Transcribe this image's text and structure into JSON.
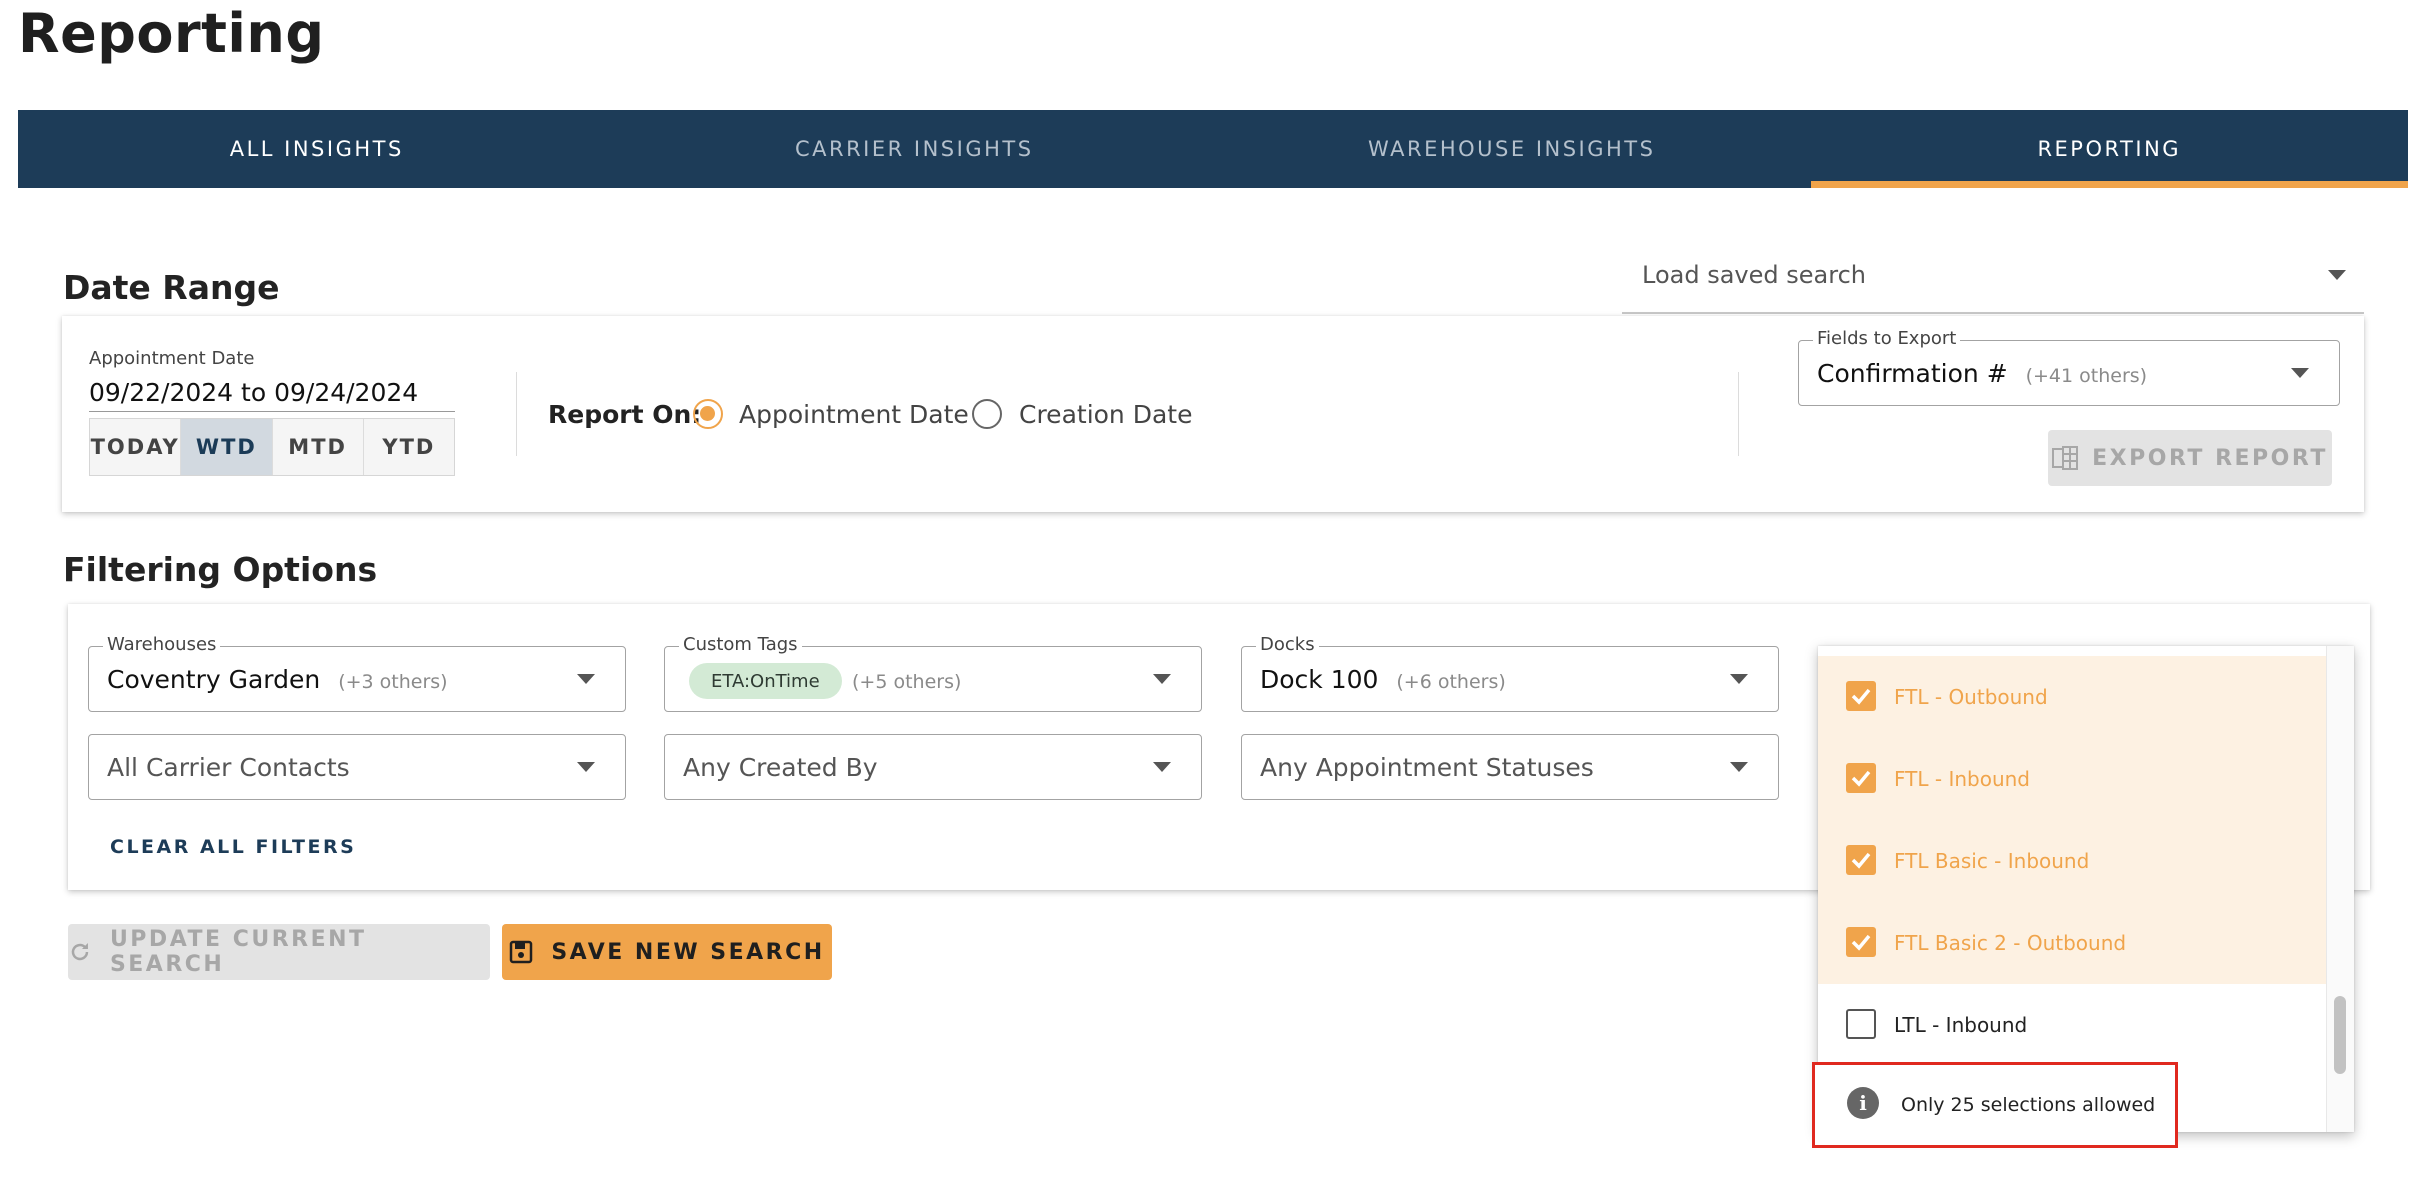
{
  "page": {
    "title": "Reporting"
  },
  "tabs": [
    "ALL INSIGHTS",
    "CARRIER INSIGHTS",
    "WAREHOUSE INSIGHTS",
    "REPORTING"
  ],
  "active_tab": "REPORTING",
  "date_range": {
    "heading": "Date Range",
    "saved_search_label": "Load saved search",
    "appointment_date_label": "Appointment Date",
    "appointment_date_value": "09/22/2024 to 09/24/2024",
    "presets": [
      "TODAY",
      "WTD",
      "MTD",
      "YTD"
    ],
    "active_preset": "WTD",
    "report_on_label": "Report On:",
    "report_on_options": [
      "Appointment Date",
      "Creation Date"
    ],
    "report_on_selected": "Appointment Date",
    "fields_to_export_label": "Fields to Export",
    "fields_to_export_value": "Confirmation #",
    "fields_to_export_more": "(+41 others)",
    "export_button": "EXPORT REPORT"
  },
  "filters": {
    "heading": "Filtering Options",
    "warehouses": {
      "label": "Warehouses",
      "value": "Coventry Garden",
      "more": "(+3 others)"
    },
    "custom_tags": {
      "label": "Custom Tags",
      "chip": "ETA:OnTime",
      "more": "(+5 others)"
    },
    "docks": {
      "label": "Docks",
      "value": "Dock 100",
      "more": "(+6 others)"
    },
    "carrier_contacts": "All Carrier Contacts",
    "created_by": "Any Created By",
    "appointment_statuses": "Any Appointment Statuses",
    "clear_all": "CLEAR ALL FILTERS"
  },
  "actions": {
    "update_search": "UPDATE CURRENT SEARCH",
    "save_search": "SAVE NEW SEARCH"
  },
  "load_type_dropdown": {
    "items": [
      {
        "label": "FTL - Outbound",
        "checked": true
      },
      {
        "label": "FTL - Inbound",
        "checked": true
      },
      {
        "label": "FTL Basic - Inbound",
        "checked": true
      },
      {
        "label": "FTL Basic 2 - Outbound",
        "checked": true
      },
      {
        "label": "LTL - Inbound",
        "checked": false
      }
    ],
    "limit_message": "Only 25 selections allowed"
  },
  "colors": {
    "nav_bg": "#1d3c58",
    "accent": "#f0a44b",
    "chip_bg": "#d3ead5",
    "alert_border": "#e0291f"
  }
}
